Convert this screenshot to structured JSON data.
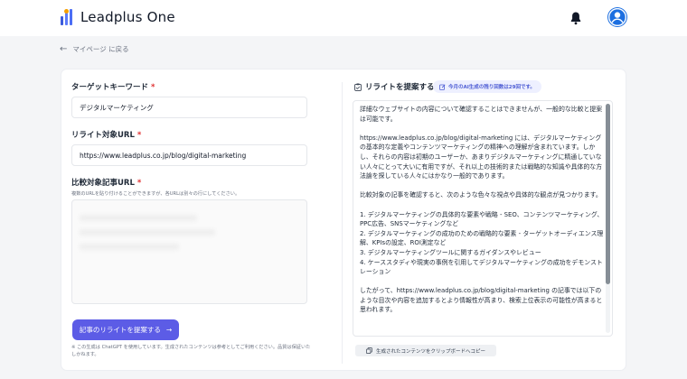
{
  "header": {
    "app_name": "Leadplus One",
    "bell_icon": "bell-icon",
    "avatar_icon": "user-avatar-icon"
  },
  "nav": {
    "back_label": "マイページ に戻る"
  },
  "form": {
    "keyword_label": "ターゲットキーワード",
    "keyword_value": "デジタルマーケティング",
    "url_label": "リライト対象URL",
    "url_value": "https://www.leadplus.co.jp/blog/digital-marketing",
    "compare_label": "比較対象記事URL",
    "compare_hint": "複数のURLを貼り付けることができますが、各URLは別々の行にしてください。",
    "required_mark": "*",
    "submit_label": "記事のリライトを提案する",
    "submit_arrow": "→",
    "disclaimer": "※ この生成は ChatGPT を使用しています。生成されたコンテンツは参考としてご利用ください。品質は保証いたしかねます。"
  },
  "result": {
    "title": "リライトを提案する",
    "badge": "今月のAI生成の残り回数は29回です。",
    "output": "詳細なウェブサイトの内容について確認することはできませんが、一般的な比較と提案は可能です。\n\nhttps://www.leadplus.co.jp/blog/digital-marketing には、デジタルマーケティングの基本的な定義やコンテンツマーケティングの精神への理解が含まれています。しかし、それらの内容は初期のユーザーか、あまりデジタルマーケティングに精通していない人々にとって大いに有用ですが、それ以上の技術的または戦略的な知識や具体的な方法論を探している人々にはかなり一般的であります。\n\n比較対象の記事を確認すると、次のような色々な視点や具体的な観点が見つかります。\n\n1. デジタルマーケティングの具体的な要素や戦略 - SEO、コンテンツマーケティング、PPC広告、SNSマーケティングなど\n2. デジタルマーケティングの成功のための戦略的な要素 - ターゲットオーディエンス理解、KPIsの設定、ROI測定など\n3. デジタルマーケティングツールに関するガイダンスやレビュー\n4. ケーススタディや現実の事例を引用してデジタルマーケティングの成功をデモンストレーション\n\nしたがって、https://www.leadplus.co.jp/blog/digital-marketing の記事では以下のような目次や内容を追加するとより情報性が高まり、検索上位表示の可能性が高まると思われます。",
    "copy_label": "生成されたコンテンツをクリップボードへコピー"
  },
  "colors": {
    "accent": "#5c5ce6",
    "required": "#e03131",
    "avatar": "#1c6fe0"
  }
}
